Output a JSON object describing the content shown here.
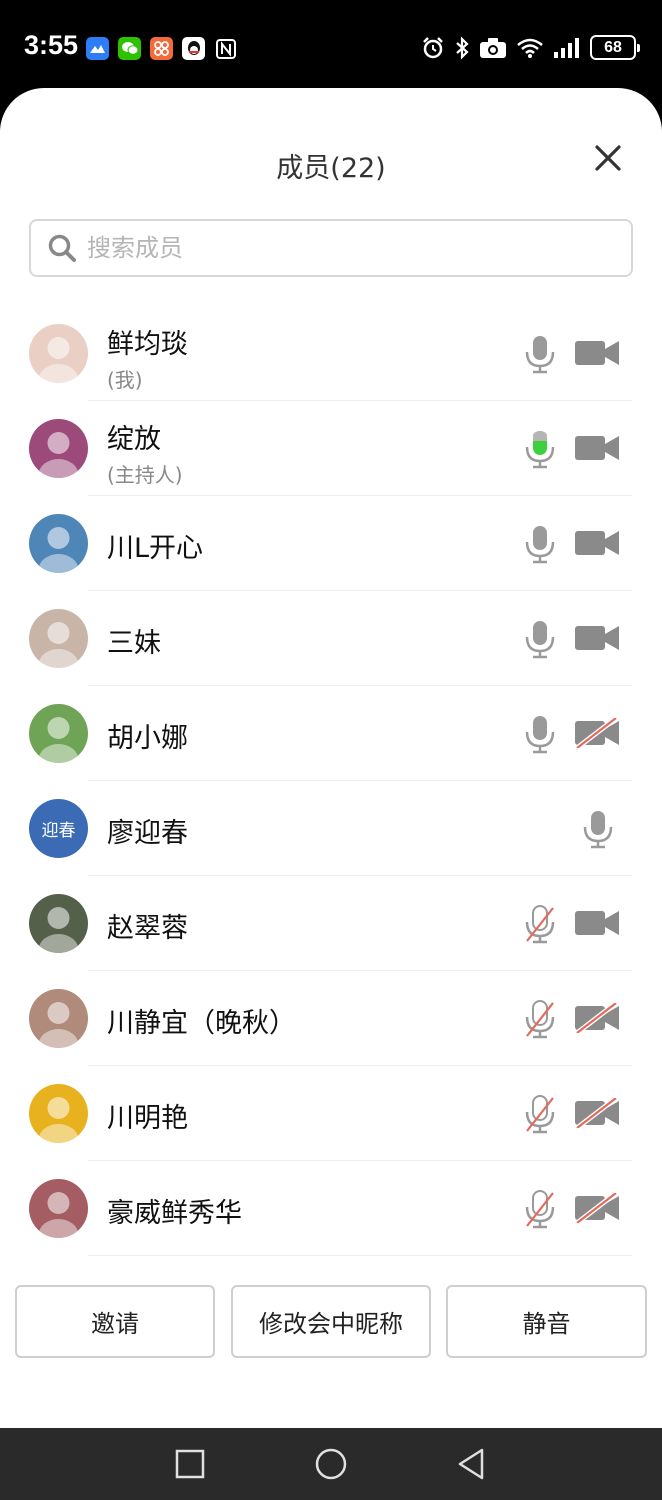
{
  "status_bar": {
    "time": "3:55",
    "battery": "68",
    "app_icons": [
      "lark-icon",
      "wechat-icon",
      "grid-app-icon",
      "qq-icon",
      "nfc-icon"
    ],
    "system_icons": [
      "alarm-icon",
      "bluetooth-icon",
      "camera-icon",
      "wifi-icon",
      "signal-icon"
    ]
  },
  "header": {
    "title": "成员(22)"
  },
  "search": {
    "placeholder": "搜索成员"
  },
  "members": [
    {
      "name": "鲜均琰",
      "role": "(我)",
      "mic": "on",
      "camera": "on",
      "avatar_color": "#e9cfc4"
    },
    {
      "name": "绽放",
      "role": "(主持人)",
      "mic": "speaking",
      "camera": "on",
      "avatar_color": "#9b4a7a"
    },
    {
      "name": "川L开心",
      "role": "",
      "mic": "on",
      "camera": "on",
      "avatar_color": "#4f86b8"
    },
    {
      "name": "三妹",
      "role": "",
      "mic": "on",
      "camera": "on",
      "avatar_color": "#c9b4a8"
    },
    {
      "name": "胡小娜",
      "role": "",
      "mic": "on",
      "camera": "off",
      "avatar_color": "#6fa356"
    },
    {
      "name": "廖迎春",
      "role": "",
      "mic": "on",
      "camera": "none",
      "avatar_color": "#3b6bb5",
      "avatar_text": "迎春"
    },
    {
      "name": "赵翠蓉",
      "role": "",
      "mic": "off",
      "camera": "on",
      "avatar_color": "#55604a"
    },
    {
      "name": "川静宜（晚秋）",
      "role": "",
      "mic": "off",
      "camera": "off",
      "avatar_color": "#b08a7a"
    },
    {
      "name": "川明艳",
      "role": "",
      "mic": "off",
      "camera": "off",
      "avatar_color": "#e8b21e"
    },
    {
      "name": "豪威鲜秀华",
      "role": "",
      "mic": "off",
      "camera": "off",
      "avatar_color": "#a35d63"
    }
  ],
  "actions": {
    "invite": "邀请",
    "rename": "修改会中昵称",
    "mute": "静音"
  },
  "colors": {
    "icon_gray": "#9a9a9a",
    "icon_dark": "#8a8a8a",
    "speaking_green": "#3ecf3e",
    "muted_slash": "#e36a5a"
  }
}
